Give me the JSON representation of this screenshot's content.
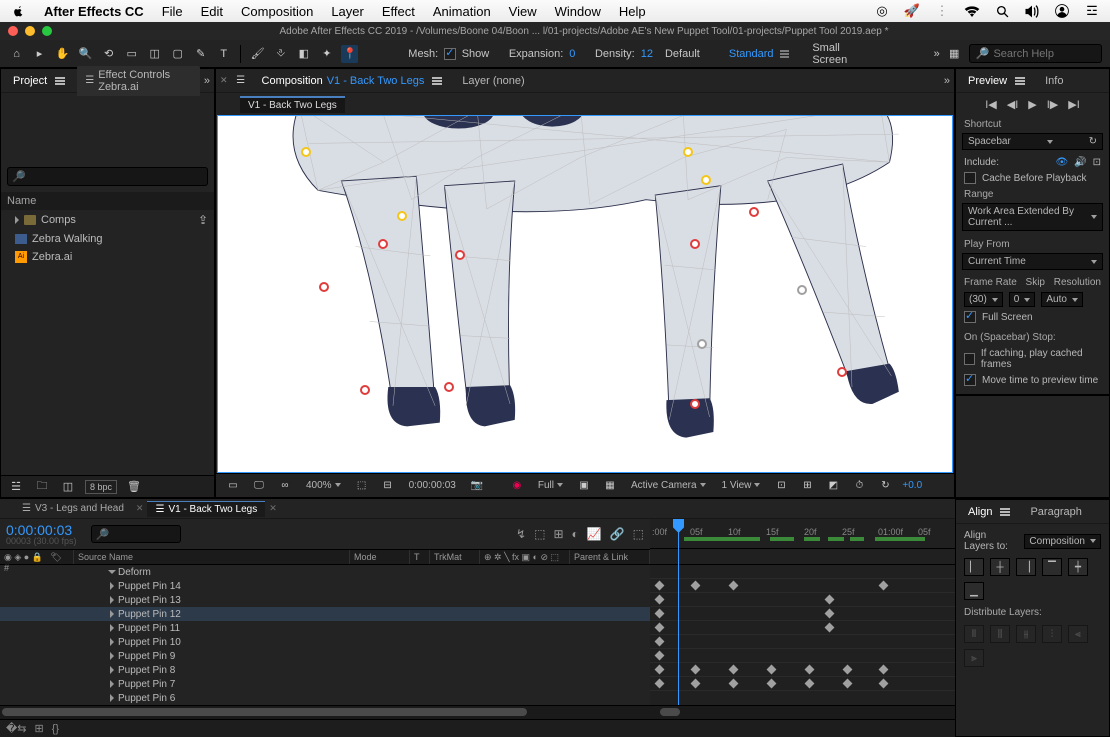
{
  "mac_menu": {
    "app": "After Effects CC",
    "items": [
      "File",
      "Edit",
      "Composition",
      "Layer",
      "Effect",
      "Animation",
      "View",
      "Window",
      "Help"
    ]
  },
  "titlebar": "Adobe After Effects CC 2019 - /Volumes/Boone 04/Boon ... l/01-projects/Adobe AE's New Puppet Tool/01-projects/Puppet Tool 2019.aep *",
  "toolbar": {
    "mesh": "Mesh:",
    "show": "Show",
    "expansion_label": "Expansion:",
    "expansion": "0",
    "density_label": "Density:",
    "density": "12",
    "workspace_default": "Default",
    "workspace_standard": "Standard",
    "workspace_small": "Small Screen",
    "search_ph": "Search Help"
  },
  "project": {
    "tabs": {
      "project": "Project",
      "effect_controls": "Effect Controls Zebra.ai"
    },
    "name_col": "Name",
    "items": {
      "folder": "Comps",
      "comp": "Zebra Walking",
      "ai": "Zebra.ai"
    },
    "footer_bpc": "8 bpc"
  },
  "comp": {
    "tab_prefix": "Composition",
    "tab_name": "V1 - Back Two Legs",
    "layer_none": "Layer (none)",
    "subtab": "V1 - Back Two Legs",
    "footer": {
      "zoom": "400%",
      "time": "0:00:00:03",
      "res": "Full",
      "camera": "Active Camera",
      "view": "1 View",
      "exposure": "+0.0"
    }
  },
  "preview": {
    "tab_preview": "Preview",
    "tab_info": "Info",
    "shortcut": "Shortcut",
    "shortcut_v": "Spacebar",
    "include": "Include:",
    "cache": "Cache Before Playback",
    "range": "Range",
    "range_v": "Work Area Extended By Current ...",
    "playfrom": "Play From",
    "playfrom_v": "Current Time",
    "fr": "Frame Rate",
    "skip": "Skip",
    "res": "Resolution",
    "fr_v": "(30)",
    "skip_v": "0",
    "res_v": "Auto",
    "fullscreen": "Full Screen",
    "onstop": "On (Spacebar) Stop:",
    "ifcache": "If caching, play cached frames",
    "movetime": "Move time to preview time"
  },
  "timeline": {
    "tabs": {
      "a": "V3 - Legs and Head",
      "b": "V1 - Back Two Legs"
    },
    "timecode": "0:00:00:03",
    "tc_sub": "00003 (30.00 fps)",
    "cols": {
      "src": "Source Name",
      "mode": "Mode",
      "t": "T",
      "trk": "TrkMat",
      "parent": "Parent & Link"
    },
    "rows": [
      "Deform",
      "Puppet Pin 14",
      "Puppet Pin 13",
      "Puppet Pin 12",
      "Puppet Pin 11",
      "Puppet Pin 10",
      "Puppet Pin 9",
      "Puppet Pin 8",
      "Puppet Pin 7",
      "Puppet Pin 6"
    ],
    "ruler": [
      ":00f",
      "05f",
      "10f",
      "15f",
      "20f",
      "25f",
      "01:00f",
      "05f"
    ]
  },
  "align": {
    "tab_align": "Align",
    "tab_para": "Paragraph",
    "layers_to": "Align Layers to:",
    "target": "Composition",
    "dist": "Distribute Layers:"
  }
}
